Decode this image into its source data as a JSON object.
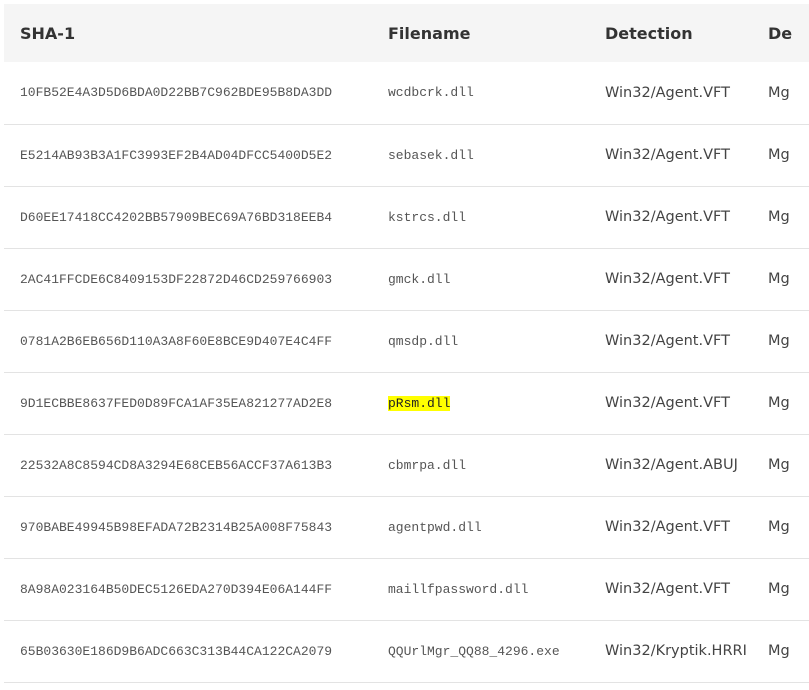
{
  "table": {
    "headers": [
      "SHA-1",
      "Filename",
      "Detection",
      "De"
    ],
    "rows": [
      {
        "sha1": "10FB52E4A3D5D6BDA0D22BB7C962BDE95B8DA3DD",
        "filename": "wcdbcrk.dll",
        "detection": "Win32/Agent.VFT",
        "desc": "Mg"
      },
      {
        "sha1": "E5214AB93B3A1FC3993EF2B4AD04DFCC5400D5E2",
        "filename": "sebasek.dll",
        "detection": "Win32/Agent.VFT",
        "desc": "Mg"
      },
      {
        "sha1": "D60EE17418CC4202BB57909BEC69A76BD318EEB4",
        "filename": "kstrcs.dll",
        "detection": "Win32/Agent.VFT",
        "desc": "Mg"
      },
      {
        "sha1": "2AC41FFCDE6C8409153DF22872D46CD259766903",
        "filename": "gmck.dll",
        "detection": "Win32/Agent.VFT",
        "desc": "Mg"
      },
      {
        "sha1": "0781A2B6EB656D110A3A8F60E8BCE9D407E4C4FF",
        "filename": "qmsdp.dll",
        "detection": "Win32/Agent.VFT",
        "desc": "Mg"
      },
      {
        "sha1": "9D1ECBBE8637FED0D89FCA1AF35EA821277AD2E8",
        "filename": "pRsm.dll",
        "detection": "Win32/Agent.VFT",
        "desc": "Mg",
        "highlighted": true
      },
      {
        "sha1": "22532A8C8594CD8A3294E68CEB56ACCF37A613B3",
        "filename": "cbmrpa.dll",
        "detection": "Win32/Agent.ABUJ",
        "desc": "Mg"
      },
      {
        "sha1": "970BABE49945B98EFADA72B2314B25A008F75843",
        "filename": "agentpwd.dll",
        "detection": "Win32/Agent.VFT",
        "desc": "Mg"
      },
      {
        "sha1": "8A98A023164B50DEC5126EDA270D394E06A144FF",
        "filename": "maillfpassword.dll",
        "detection": "Win32/Agent.VFT",
        "desc": "Mg"
      },
      {
        "sha1": "65B03630E186D9B6ADC663C313B44CA122CA2079",
        "filename": "QQUrlMgr_QQ88_4296.exe",
        "detection": "Win32/Kryptik.HRRI",
        "desc": "Mg"
      }
    ]
  },
  "colors": {
    "header_bg": "#f5f5f5",
    "highlight": "#ffff00",
    "row_border": "#e3e3e3"
  }
}
